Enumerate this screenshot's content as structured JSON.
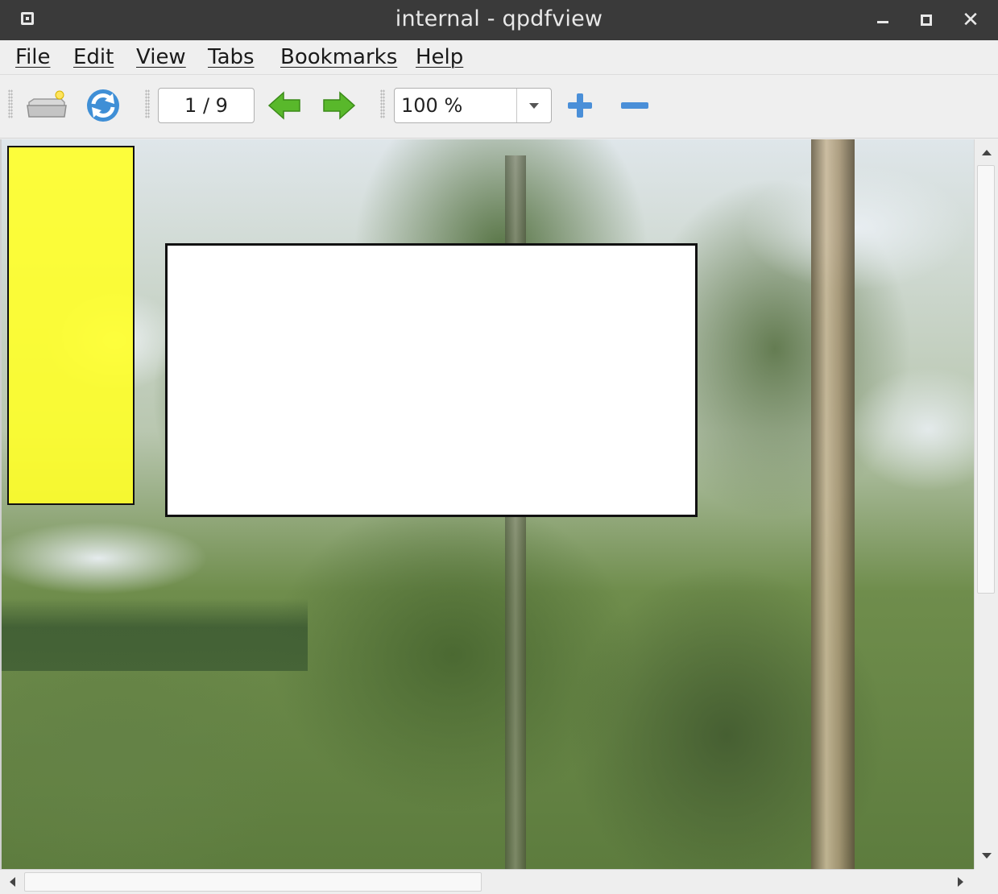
{
  "window": {
    "title": "internal - qpdfview"
  },
  "menubar": {
    "items": [
      {
        "label": "File"
      },
      {
        "label": "Edit"
      },
      {
        "label": "View"
      },
      {
        "label": "Tabs"
      },
      {
        "label": "Bookmarks"
      },
      {
        "label": "Help"
      }
    ]
  },
  "toolbar": {
    "open_icon": "open-folder-icon",
    "refresh_icon": "refresh-icon",
    "page_indicator": "1 / 9",
    "prev_icon": "previous-page-icon",
    "next_icon": "next-page-icon",
    "zoom_value": "100 %",
    "zoom_in_icon": "zoom-in-icon",
    "zoom_out_icon": "zoom-out-icon"
  },
  "document": {
    "annotations": [
      {
        "kind": "highlight",
        "color": "#ffff28"
      },
      {
        "kind": "box",
        "color": "#ffffff"
      }
    ]
  },
  "colors": {
    "titlebar": "#3a3a3a",
    "arrow_green": "#4caf22",
    "zoom_blue": "#4a8fd8"
  }
}
